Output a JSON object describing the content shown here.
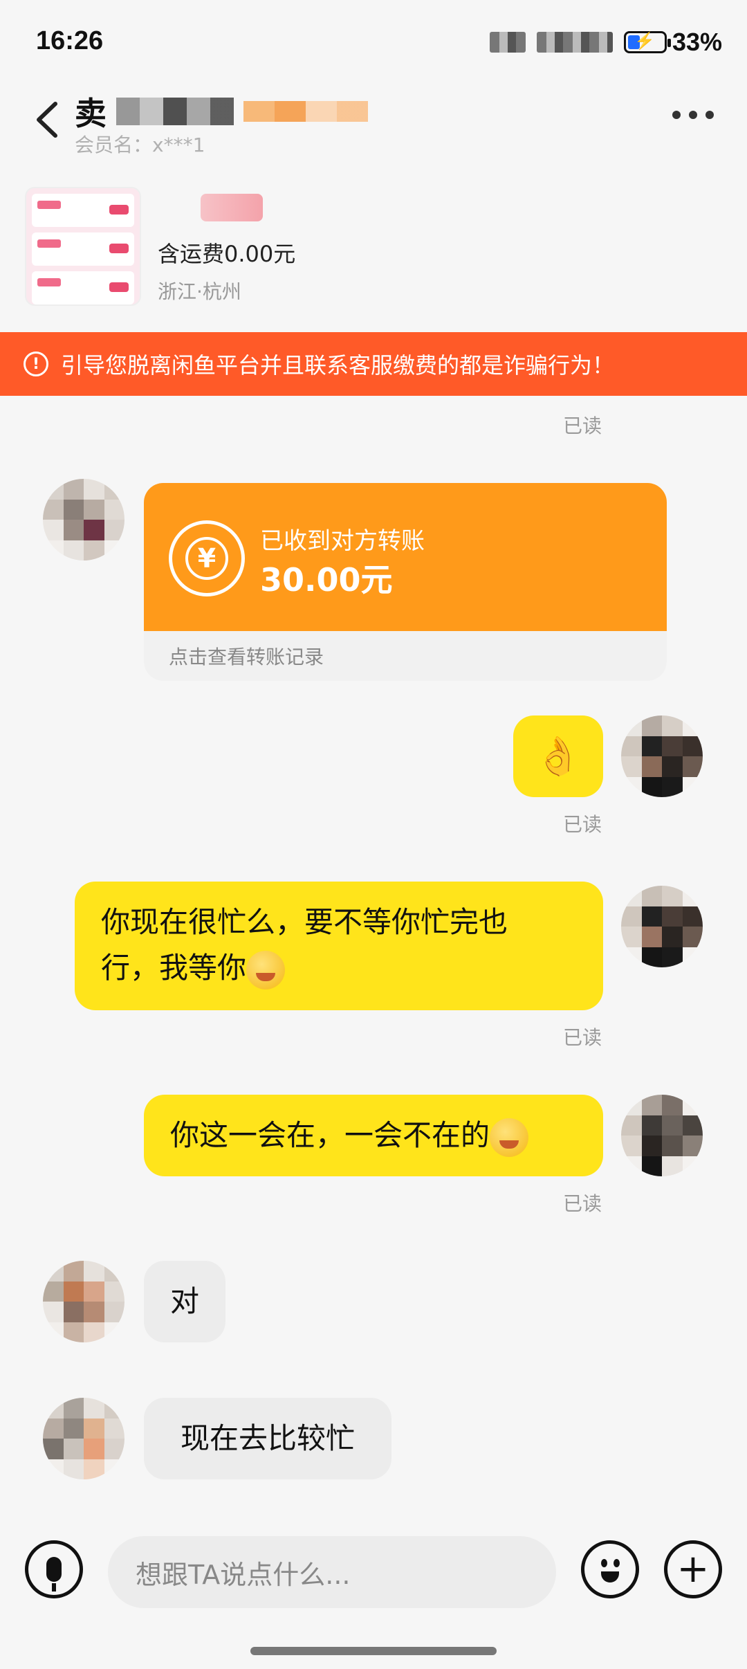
{
  "status_bar": {
    "time": "16:26",
    "battery": "33%"
  },
  "header": {
    "title": "卖",
    "member_label": "会员名：x***1"
  },
  "product": {
    "shipping": "含运费0.00元",
    "location": "浙江·杭州"
  },
  "warning": {
    "text": "引导您脱离闲鱼平台并且联系客服缴费的都是诈骗行为！"
  },
  "messages": {
    "read_top": "已读",
    "transfer": {
      "title": "已收到对方转账",
      "amount": "30.00元",
      "link": "点击查看转账记录"
    },
    "ok_read": "已读",
    "me1": {
      "line1": "你现在很忙么，要不等你忙完也",
      "line2": "行，我等你",
      "read": "已读"
    },
    "me2": {
      "text": "你这一会在，一会不在的",
      "read": "已读"
    },
    "other1": {
      "text": "对"
    },
    "other2": {
      "text": "现在去比较忙"
    }
  },
  "input": {
    "placeholder": "想跟TA说点什么..."
  },
  "icons": {
    "back": "chevron-left-icon",
    "more": "more-icon",
    "warning": "warning-circle-icon",
    "yen": "yen-transfer-icon",
    "ok": "ok-hand-icon",
    "mic": "microphone-icon",
    "emoji": "emoji-icon",
    "plus": "plus-icon"
  },
  "colors": {
    "accent_yellow": "#ffe41b",
    "warning_orange": "#ff5a28",
    "transfer_orange": "#ff9a1a"
  }
}
